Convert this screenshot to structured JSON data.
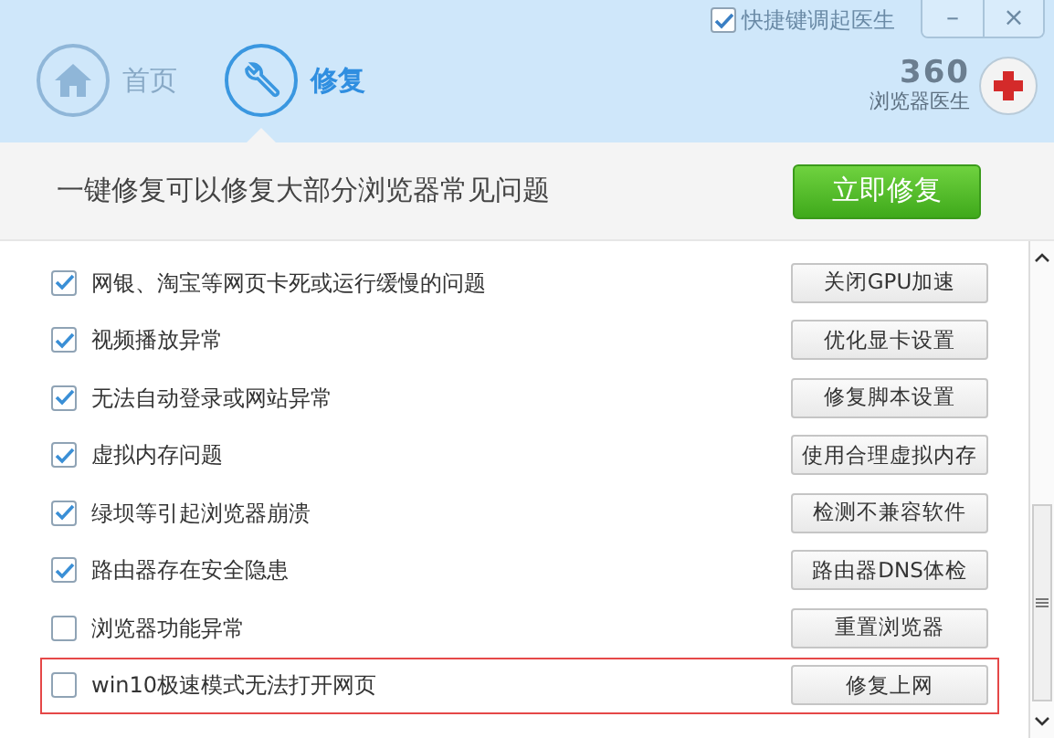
{
  "window": {
    "hotkey_option": {
      "label": "快捷键调起医生",
      "checked": true
    },
    "controls": [
      "–",
      "×"
    ]
  },
  "tabs": [
    {
      "label": "首页",
      "kind": "home",
      "selected": false
    },
    {
      "label": "修复",
      "kind": "repair",
      "selected": true
    }
  ],
  "brand": {
    "number": "360",
    "name": "浏览器医生"
  },
  "banner": {
    "text": "一键修复可以修复大部分浏览器常见问题",
    "button": "立即修复"
  },
  "items": [
    {
      "label": "网银、淘宝等网页卡死或运行缓慢的问题",
      "checked": true,
      "button": "关闭GPU加速",
      "highlighted": false
    },
    {
      "label": "视频播放异常",
      "checked": true,
      "button": "优化显卡设置",
      "highlighted": false
    },
    {
      "label": "无法自动登录或网站异常",
      "checked": true,
      "button": "修复脚本设置",
      "highlighted": false
    },
    {
      "label": "虚拟内存问题",
      "checked": true,
      "button": "使用合理虚拟内存",
      "highlighted": false
    },
    {
      "label": "绿坝等引起浏览器崩溃",
      "checked": true,
      "button": "检测不兼容软件",
      "highlighted": false
    },
    {
      "label": "路由器存在安全隐患",
      "checked": true,
      "button": "路由器DNS体检",
      "highlighted": false
    },
    {
      "label": "浏览器功能异常",
      "checked": false,
      "button": "重置浏览器",
      "highlighted": false
    },
    {
      "label": "win10极速模式无法打开网页",
      "checked": false,
      "button": "修复上网",
      "highlighted": true
    }
  ]
}
